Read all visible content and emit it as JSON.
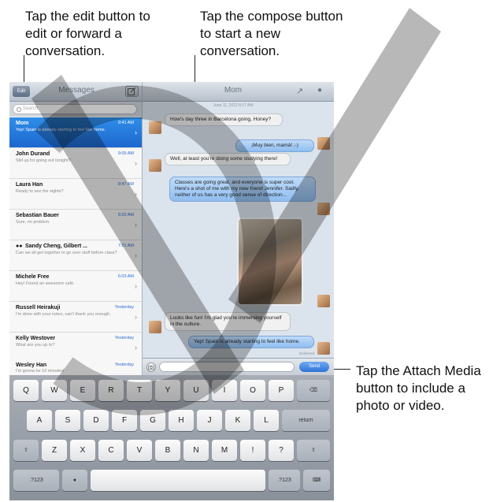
{
  "callouts": {
    "edit": "Tap the edit button to edit or forward a conversation.",
    "compose": "Tap the compose button to start a new conversation.",
    "attach": "Tap the Attach Media button to include a photo or video."
  },
  "sidebar": {
    "edit_label": "Edit",
    "title": "Messages",
    "search_placeholder": "Search",
    "conversations": [
      {
        "name": "Mom",
        "time": "9:41 AM",
        "preview": "Yep! Spain is already starting to feel like home."
      },
      {
        "name": "John Durand",
        "time": "9:05 AM",
        "preview": "Still up for going out tonight?"
      },
      {
        "name": "Laura Han",
        "time": "8:47 AM",
        "preview": "Ready to see the sights?"
      },
      {
        "name": "Sebastian Bauer",
        "time": "8:20 AM",
        "preview": "Sure, no problem."
      },
      {
        "name": "Sandy Cheng, Gilbert ...",
        "time": "7:51 AM",
        "preview": "Can we all get together to go over stuff before class?"
      },
      {
        "name": "Michele Free",
        "time": "6:03 AM",
        "preview": "Hey! Found an awesome café."
      },
      {
        "name": "Russell Heirakuji",
        "time": "Yesterday",
        "preview": "I'm done with your notes, can't thank you enough."
      },
      {
        "name": "Kelly Westover",
        "time": "Yesterday",
        "preview": "What are you up to?"
      },
      {
        "name": "Wesley Han",
        "time": "Yesterday",
        "preview": "I'm gonna be 10 minutes!"
      }
    ]
  },
  "chat": {
    "title": "Mom",
    "timestamp": "June 11, 2012 8:17 AM",
    "messages": [
      {
        "from": "in",
        "text": "How's day three in Barcelona going, Honey?"
      },
      {
        "from": "out",
        "text": "¡Muy bien, mamá! ;-)"
      },
      {
        "from": "in",
        "text": "Well, at least you're doing some studying there!"
      },
      {
        "from": "out",
        "text": "Classes are going great, and everyone is super cool. Here's a shot of me with my new friend Jennifer. Sadly, neither of us has a very good sense of direction..."
      },
      {
        "from": "in",
        "text": "Looks like fun! I'm glad you're immersing yourself in the culture."
      },
      {
        "from": "out",
        "text": "Yep! Spain is already starting to feel like home."
      }
    ],
    "status": "Delivered",
    "send_label": "Send"
  },
  "keyboard": {
    "row1": [
      "Q",
      "W",
      "E",
      "R",
      "T",
      "Y",
      "U",
      "I",
      "O",
      "P"
    ],
    "row2": [
      "A",
      "S",
      "D",
      "F",
      "G",
      "H",
      "J",
      "K",
      "L"
    ],
    "return_label": "return",
    "row3": [
      "Z",
      "X",
      "C",
      "V",
      "B",
      "N",
      "M",
      "!",
      "?"
    ],
    "num_label": ".?123"
  },
  "colors": {
    "accent": "#2f74d6",
    "selected_row": "#2a7fe0"
  }
}
